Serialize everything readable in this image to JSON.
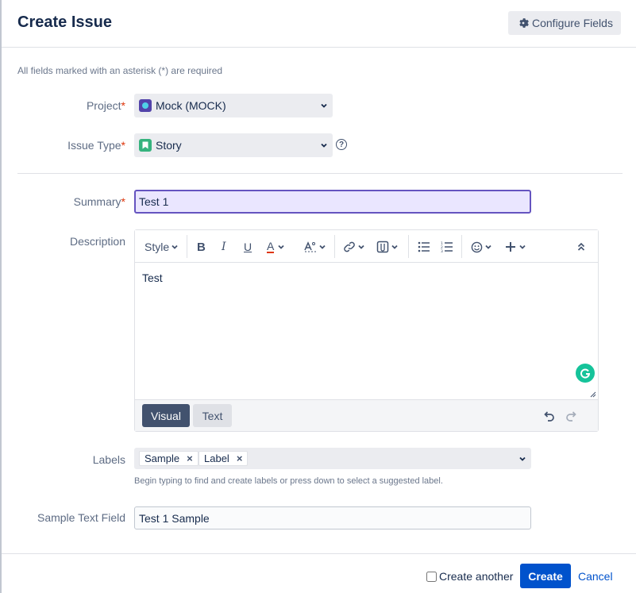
{
  "dialog": {
    "title": "Create Issue",
    "configure_fields_label": "Configure Fields",
    "required_note": "All fields marked with an asterisk (*) are required"
  },
  "fields": {
    "project": {
      "label": "Project",
      "required_mark": "*",
      "value": "Mock (MOCK)"
    },
    "issue_type": {
      "label": "Issue Type",
      "required_mark": "*",
      "value": "Story"
    },
    "summary": {
      "label": "Summary",
      "required_mark": "*",
      "value": "Test 1"
    },
    "description": {
      "label": "Description",
      "toolbar": {
        "style_label": "Style"
      },
      "content": "Test",
      "modes": {
        "visual": "Visual",
        "text": "Text"
      }
    },
    "labels": {
      "label": "Labels",
      "tags": [
        "Sample",
        "Label"
      ],
      "hint": "Begin typing to find and create labels or press down to select a suggested label."
    },
    "sample_text_field": {
      "label": "Sample Text Field",
      "value": "Test 1 Sample"
    }
  },
  "footer": {
    "create_another_label": "Create another",
    "create_label": "Create",
    "cancel_label": "Cancel"
  },
  "colors": {
    "primary": "#0052cc",
    "focus_border": "#6554c0",
    "required": "#de350b",
    "story": "#36b37e",
    "grammarly": "#15c39a"
  }
}
